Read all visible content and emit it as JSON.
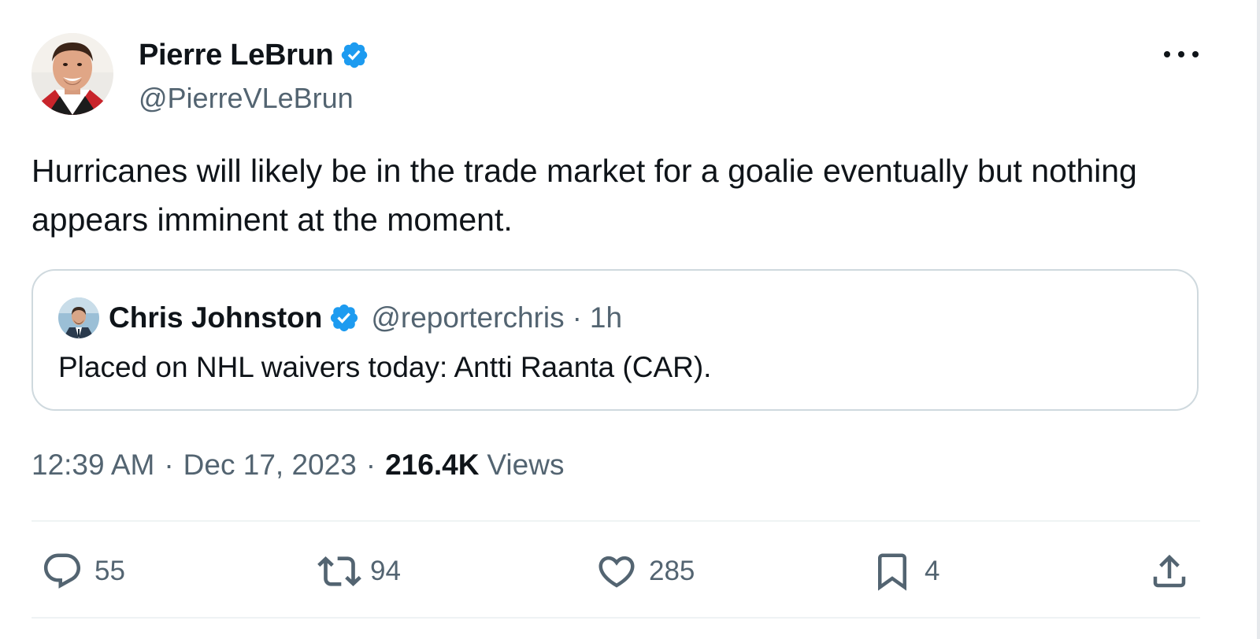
{
  "tweet": {
    "author": {
      "display_name": "Pierre LeBrun",
      "handle": "@PierreVLeBrun",
      "verified": true
    },
    "text": "Hurricanes will likely be in the trade market for a goalie eventually but nothing appears imminent at the moment.",
    "quoted": {
      "display_name": "Chris Johnston",
      "handle": "@reporterchris",
      "separator": "·",
      "age": "1h",
      "text": "Placed on NHL waivers today: Antti Raanta (CAR)."
    },
    "meta": {
      "time": "12:39 AM",
      "sep1": "·",
      "date": "Dec 17, 2023",
      "sep2": "·",
      "views_count": "216.4K",
      "views_label": "Views"
    },
    "actions": {
      "replies": "55",
      "reposts": "94",
      "likes": "285",
      "bookmarks": "4"
    }
  },
  "colors": {
    "text_primary": "#0f1419",
    "text_secondary": "#536471",
    "verified_blue": "#1d9bf0",
    "border": "#cfd9de"
  },
  "icons": [
    "verified-icon",
    "more-icon",
    "reply-icon",
    "repost-icon",
    "like-icon",
    "bookmark-icon",
    "share-icon"
  ]
}
